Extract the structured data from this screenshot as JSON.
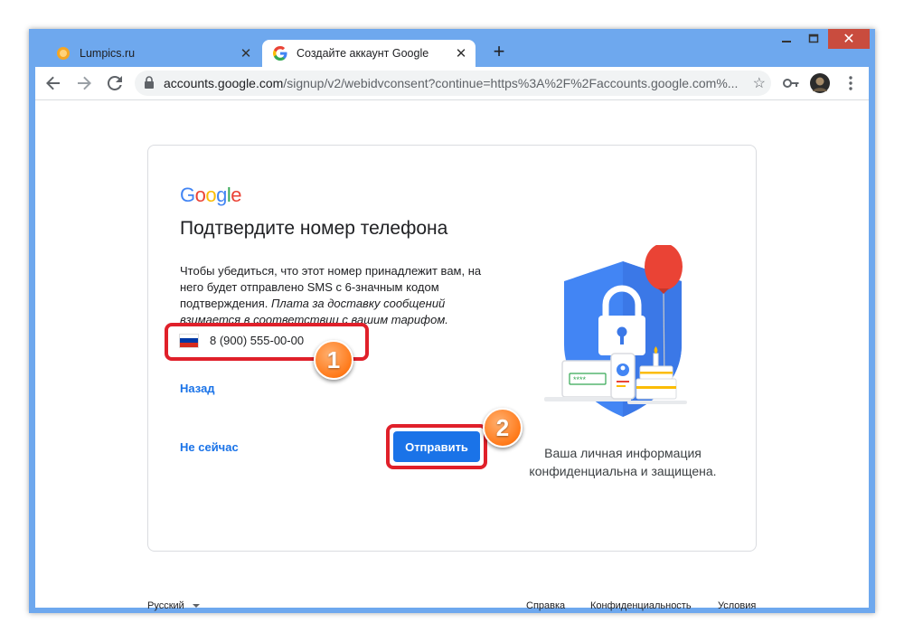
{
  "tabs": [
    {
      "title": "Lumpics.ru",
      "close": "✕"
    },
    {
      "title": "Создайте аккаунт Google",
      "close": "✕"
    }
  ],
  "new_tab": "+",
  "window_controls": {
    "minimize": "—",
    "maximize": "☐",
    "close": "✕"
  },
  "address_bar": {
    "host": "accounts.google.com",
    "path": "/signup/v2/webidvconsent?continue=https%3A%2F%2Faccounts.google.com%..."
  },
  "card": {
    "logo": "Google",
    "heading": "Подтвердите номер телефона",
    "description": "Чтобы убедиться, что этот номер принадлежит вам, на него будет отправлено SMS с 6-значным кодом подтверждения.",
    "description_italic": "Плата за доставку сообщений взимается в соответствии с вашим тарифом.",
    "phone": "8 (900) 555-00-00",
    "back_link": "Назад",
    "skip_link": "Не сейчас",
    "send_button": "Отправить",
    "caption": "Ваша личная информация конфиденциальна и защищена.",
    "password_mask": "****"
  },
  "annotations": {
    "marker1": "1",
    "marker2": "2",
    "color": "#e0202a"
  },
  "footer": {
    "language": "Русский",
    "help": "Справка",
    "privacy": "Конфиденциальность",
    "terms": "Условия"
  },
  "colors": {
    "blue": "#4285f4",
    "red": "#ea4335",
    "yellow": "#fbbc05",
    "green": "#34a853",
    "link": "#1a73e8",
    "window_frame": "#6ea8ee"
  },
  "icons": [
    "lumpics-favicon",
    "google-favicon",
    "back-arrow-icon",
    "forward-arrow-icon",
    "reload-icon",
    "lock-icon",
    "star-icon",
    "key-icon",
    "avatar",
    "menu-dots-icon",
    "russia-flag-icon",
    "dropdown-arrow-icon"
  ]
}
